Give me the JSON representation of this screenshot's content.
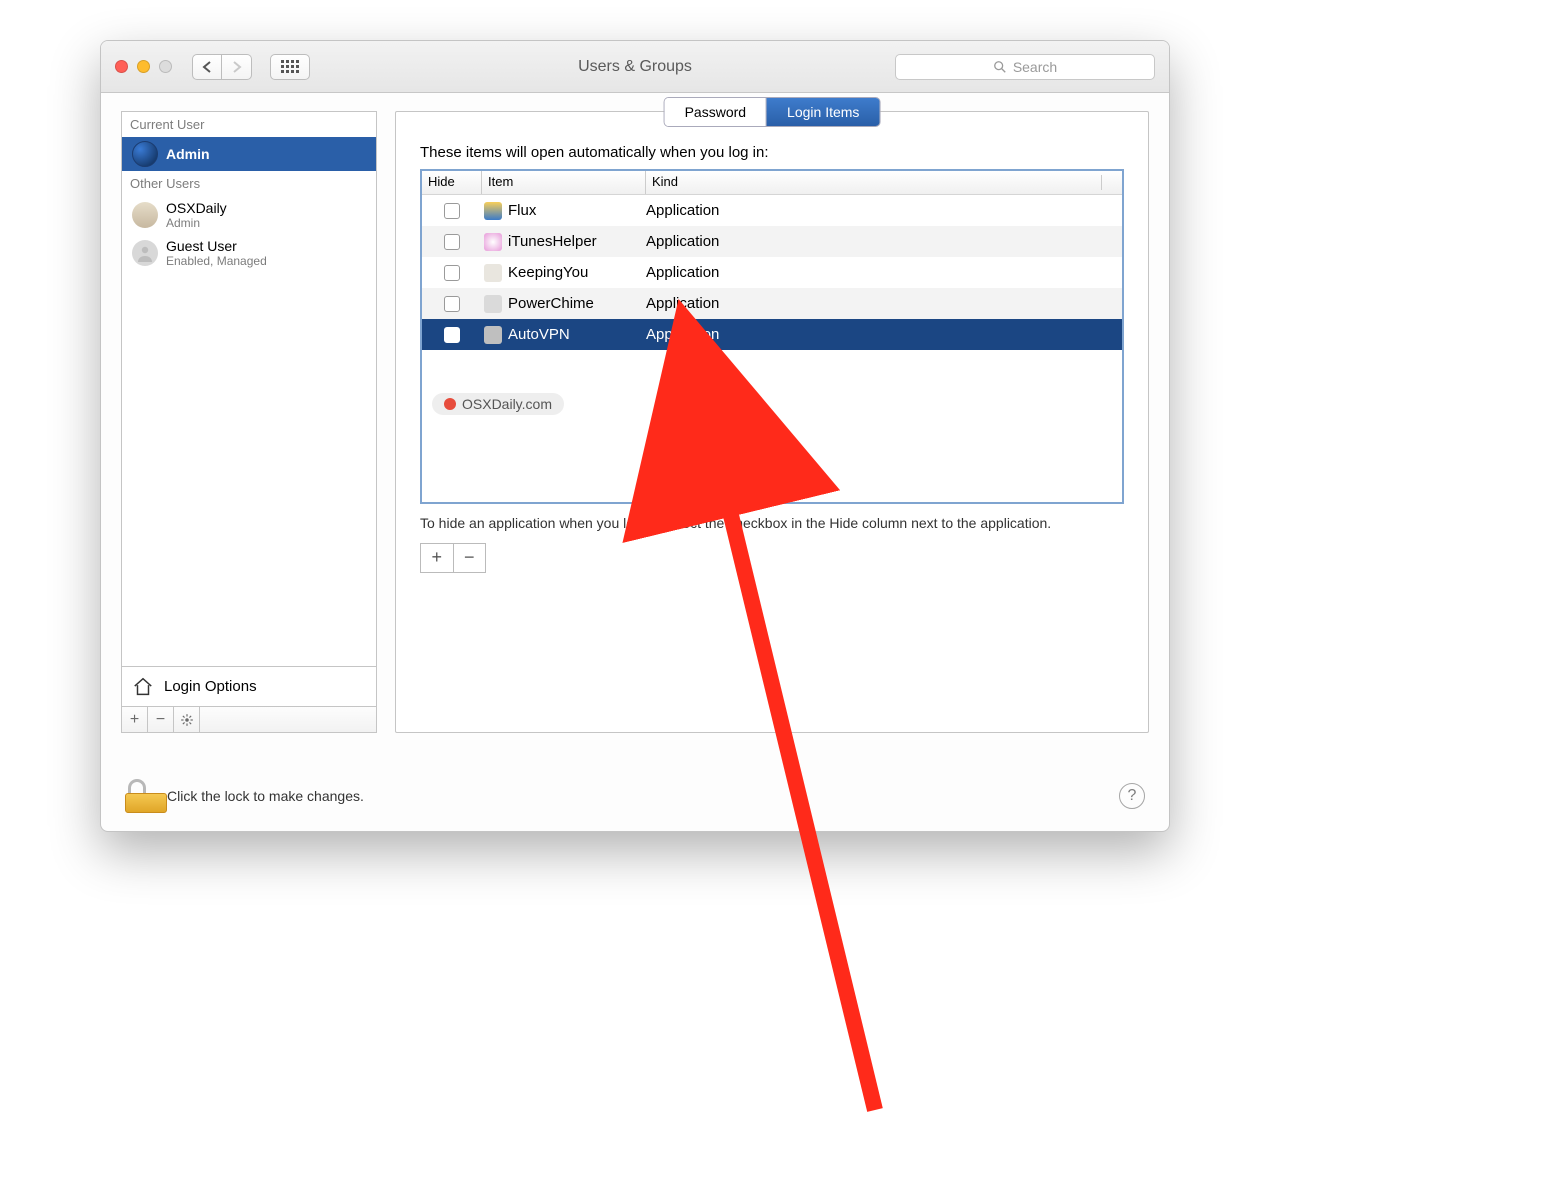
{
  "window": {
    "title": "Users & Groups"
  },
  "search": {
    "placeholder": "Search"
  },
  "sidebar": {
    "current_label": "Current User",
    "other_label": "Other Users",
    "current": {
      "name": "Admin"
    },
    "others": [
      {
        "name": "OSXDaily",
        "sub": "Admin"
      },
      {
        "name": "Guest User",
        "sub": "Enabled, Managed"
      }
    ],
    "login_options": "Login Options"
  },
  "tabs": {
    "password": "Password",
    "login_items": "Login Items"
  },
  "main": {
    "intro": "These items will open automatically when you log in:",
    "columns": {
      "hide": "Hide",
      "item": "Item",
      "kind": "Kind"
    },
    "rows": [
      {
        "name": "Flux",
        "kind": "Application",
        "icon_bg": "linear-gradient(#f8cf5a,#3b7bc8)",
        "selected": false
      },
      {
        "name": "iTunesHelper",
        "kind": "Application",
        "icon_bg": "radial-gradient(circle,#fff,#e79ad9)",
        "selected": false
      },
      {
        "name": "KeepingYou",
        "kind": "Application",
        "icon_bg": "#e9e6df",
        "selected": false
      },
      {
        "name": "PowerChime",
        "kind": "Application",
        "icon_bg": "#dadada",
        "selected": false
      },
      {
        "name": "AutoVPN",
        "kind": "Application",
        "icon_bg": "#bfbfbf",
        "selected": true
      }
    ],
    "watermark": "OSXDaily.com",
    "note": "To hide an application when you log in, select the checkbox in the Hide column next to the application."
  },
  "footer": {
    "lock_text": "Click the lock to make changes."
  }
}
